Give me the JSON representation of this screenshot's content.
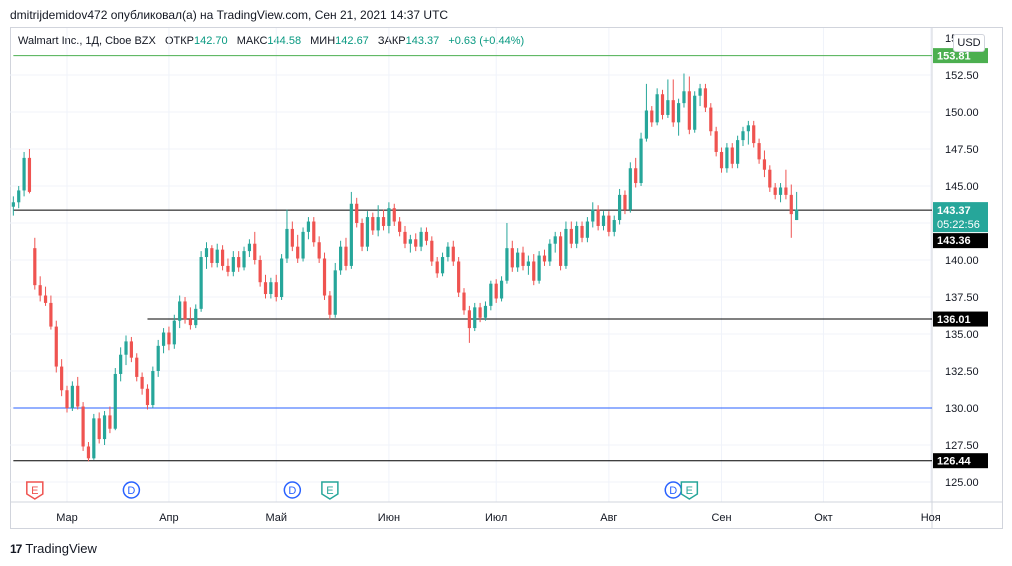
{
  "header": {
    "publisher_line": "dmitrijdemidov472 опубликовал(а) на TradingView.com, Сен 21, 2021 14:37 UTC"
  },
  "legend": {
    "symbol": "Walmart Inc., 1Д, Cboe BZX",
    "open_label": "ОТКР",
    "open": "142.70",
    "high_label": "МАКС",
    "high": "144.58",
    "low_label": "МИН",
    "low": "142.67",
    "close_label": "ЗАКР",
    "close": "143.37",
    "change": "+0.63 (+0.44%)"
  },
  "currency": "USD",
  "footer": {
    "brand": "TradingView"
  },
  "colors": {
    "up": "#26a69a",
    "down": "#ef5350",
    "green_line": "#4caf50",
    "blue_line": "#2962ff",
    "black_line": "#000000"
  },
  "chart_data": {
    "type": "candlestick",
    "y_ticks": [
      "125.00",
      "127.50",
      "130.00",
      "132.50",
      "135.00",
      "137.50",
      "140.00",
      "142.50",
      "145.00",
      "147.50",
      "150.00",
      "152.50"
    ],
    "y_top_partial": "15",
    "ylim": [
      123.3,
      155.3
    ],
    "x_ticks": [
      {
        "label": "Мар",
        "t": 0
      },
      {
        "label": "Апр",
        "t": 19
      },
      {
        "label": "Май",
        "t": 39
      },
      {
        "label": "Июн",
        "t": 60
      },
      {
        "label": "Июл",
        "t": 80
      },
      {
        "label": "Авг",
        "t": 101
      },
      {
        "label": "Сен",
        "t": 122
      },
      {
        "label": "Окт",
        "t": 141
      },
      {
        "label": "Ноя",
        "t": 161
      }
    ],
    "horizontal_lines": [
      {
        "price": 153.81,
        "label": "153.81",
        "color": "green",
        "x_from": -10
      },
      {
        "price": 143.37,
        "label": "143.36",
        "color": "black",
        "x_from": -10
      },
      {
        "price": 136.01,
        "label": "136.01",
        "color": "black",
        "x_from": 15
      },
      {
        "price": 130.0,
        "label": "",
        "color": "blue",
        "x_from": -10
      },
      {
        "price": 126.44,
        "label": "126.44",
        "color": "black",
        "x_from": -10
      }
    ],
    "last_price": {
      "price": 143.37,
      "label": "143.37",
      "countdown": "05:22:56"
    },
    "events": [
      {
        "type": "E",
        "t": -6,
        "color": "down"
      },
      {
        "type": "D",
        "t": 12,
        "color": "blue"
      },
      {
        "type": "D",
        "t": 42,
        "color": "blue"
      },
      {
        "type": "E",
        "t": 49,
        "color": "up"
      },
      {
        "type": "D",
        "t": 113,
        "color": "blue"
      },
      {
        "type": "E",
        "t": 116,
        "color": "up"
      }
    ],
    "candles": [
      {
        "t": -10,
        "o": 143.6,
        "h": 144.3,
        "l": 143.0,
        "c": 143.9
      },
      {
        "t": -9,
        "o": 143.9,
        "h": 145.0,
        "l": 143.5,
        "c": 144.7
      },
      {
        "t": -8,
        "o": 144.7,
        "h": 147.3,
        "l": 144.3,
        "c": 146.9
      },
      {
        "t": -7,
        "o": 146.9,
        "h": 147.5,
        "l": 144.5,
        "c": 144.6
      },
      {
        "t": -6,
        "o": 140.8,
        "h": 141.5,
        "l": 138.0,
        "c": 138.3
      },
      {
        "t": -5,
        "o": 138.3,
        "h": 138.9,
        "l": 137.2,
        "c": 137.6
      },
      {
        "t": -4,
        "o": 137.6,
        "h": 138.2,
        "l": 136.9,
        "c": 137.1
      },
      {
        "t": -3,
        "o": 137.1,
        "h": 137.6,
        "l": 135.3,
        "c": 135.5
      },
      {
        "t": -2,
        "o": 135.5,
        "h": 135.9,
        "l": 132.4,
        "c": 132.8
      },
      {
        "t": -1,
        "o": 132.8,
        "h": 133.3,
        "l": 130.8,
        "c": 131.2
      },
      {
        "t": 0,
        "o": 131.2,
        "h": 131.5,
        "l": 129.7,
        "c": 130.0
      },
      {
        "t": 1,
        "o": 130.0,
        "h": 131.8,
        "l": 129.8,
        "c": 131.5
      },
      {
        "t": 2,
        "o": 131.5,
        "h": 132.1,
        "l": 129.9,
        "c": 130.1
      },
      {
        "t": 3,
        "o": 130.1,
        "h": 130.4,
        "l": 127.1,
        "c": 127.4
      },
      {
        "t": 4,
        "o": 127.4,
        "h": 127.7,
        "l": 126.4,
        "c": 126.6
      },
      {
        "t": 5,
        "o": 126.6,
        "h": 129.6,
        "l": 126.5,
        "c": 129.3
      },
      {
        "t": 6,
        "o": 129.3,
        "h": 129.7,
        "l": 127.6,
        "c": 127.9
      },
      {
        "t": 7,
        "o": 127.9,
        "h": 129.8,
        "l": 127.5,
        "c": 129.5
      },
      {
        "t": 8,
        "o": 129.5,
        "h": 130.1,
        "l": 128.3,
        "c": 128.6
      },
      {
        "t": 9,
        "o": 128.6,
        "h": 132.7,
        "l": 128.5,
        "c": 132.3
      },
      {
        "t": 10,
        "o": 132.3,
        "h": 134.1,
        "l": 131.8,
        "c": 133.6
      },
      {
        "t": 11,
        "o": 133.6,
        "h": 134.9,
        "l": 132.9,
        "c": 134.5
      },
      {
        "t": 12,
        "o": 134.5,
        "h": 134.8,
        "l": 133.1,
        "c": 133.4
      },
      {
        "t": 13,
        "o": 133.4,
        "h": 133.7,
        "l": 131.8,
        "c": 132.1
      },
      {
        "t": 14,
        "o": 132.1,
        "h": 132.4,
        "l": 130.9,
        "c": 131.3
      },
      {
        "t": 15,
        "o": 131.3,
        "h": 131.6,
        "l": 129.9,
        "c": 130.2
      },
      {
        "t": 16,
        "o": 130.2,
        "h": 132.8,
        "l": 130.0,
        "c": 132.5
      },
      {
        "t": 17,
        "o": 132.5,
        "h": 134.6,
        "l": 132.1,
        "c": 134.2
      },
      {
        "t": 18,
        "o": 134.2,
        "h": 135.4,
        "l": 133.7,
        "c": 135.1
      },
      {
        "t": 19,
        "o": 135.1,
        "h": 135.5,
        "l": 133.9,
        "c": 134.3
      },
      {
        "t": 20,
        "o": 134.3,
        "h": 136.3,
        "l": 134.0,
        "c": 135.9
      },
      {
        "t": 21,
        "o": 135.9,
        "h": 137.6,
        "l": 135.4,
        "c": 137.2
      },
      {
        "t": 22,
        "o": 137.2,
        "h": 137.5,
        "l": 135.7,
        "c": 136.0
      },
      {
        "t": 23,
        "o": 136.0,
        "h": 136.8,
        "l": 135.3,
        "c": 135.6
      },
      {
        "t": 24,
        "o": 135.6,
        "h": 137.0,
        "l": 135.4,
        "c": 136.7
      },
      {
        "t": 25,
        "o": 136.7,
        "h": 140.6,
        "l": 136.5,
        "c": 140.2
      },
      {
        "t": 26,
        "o": 140.2,
        "h": 141.2,
        "l": 139.4,
        "c": 140.8
      },
      {
        "t": 27,
        "o": 140.8,
        "h": 141.0,
        "l": 139.5,
        "c": 139.8
      },
      {
        "t": 28,
        "o": 139.8,
        "h": 141.1,
        "l": 139.5,
        "c": 140.7
      },
      {
        "t": 29,
        "o": 140.7,
        "h": 141.0,
        "l": 139.3,
        "c": 139.6
      },
      {
        "t": 30,
        "o": 139.6,
        "h": 140.1,
        "l": 138.9,
        "c": 139.2
      },
      {
        "t": 31,
        "o": 139.2,
        "h": 140.6,
        "l": 138.9,
        "c": 140.2
      },
      {
        "t": 32,
        "o": 140.2,
        "h": 140.6,
        "l": 139.2,
        "c": 139.5
      },
      {
        "t": 33,
        "o": 139.5,
        "h": 140.9,
        "l": 139.3,
        "c": 140.6
      },
      {
        "t": 34,
        "o": 140.6,
        "h": 141.4,
        "l": 140.2,
        "c": 141.1
      },
      {
        "t": 35,
        "o": 141.1,
        "h": 141.9,
        "l": 139.7,
        "c": 140.0
      },
      {
        "t": 36,
        "o": 140.0,
        "h": 140.3,
        "l": 138.2,
        "c": 138.5
      },
      {
        "t": 37,
        "o": 138.5,
        "h": 139.0,
        "l": 137.4,
        "c": 137.7
      },
      {
        "t": 38,
        "o": 137.7,
        "h": 138.8,
        "l": 137.4,
        "c": 138.5
      },
      {
        "t": 39,
        "o": 138.5,
        "h": 139.0,
        "l": 137.2,
        "c": 137.5
      },
      {
        "t": 40,
        "o": 137.5,
        "h": 140.4,
        "l": 137.3,
        "c": 140.1
      },
      {
        "t": 41,
        "o": 140.1,
        "h": 143.4,
        "l": 139.8,
        "c": 142.1
      },
      {
        "t": 42,
        "o": 142.1,
        "h": 142.6,
        "l": 140.6,
        "c": 140.9
      },
      {
        "t": 43,
        "o": 140.9,
        "h": 141.7,
        "l": 139.8,
        "c": 140.1
      },
      {
        "t": 44,
        "o": 140.1,
        "h": 142.2,
        "l": 139.9,
        "c": 141.9
      },
      {
        "t": 45,
        "o": 141.9,
        "h": 142.9,
        "l": 141.4,
        "c": 142.6
      },
      {
        "t": 46,
        "o": 142.6,
        "h": 142.9,
        "l": 140.9,
        "c": 141.2
      },
      {
        "t": 47,
        "o": 141.2,
        "h": 141.6,
        "l": 139.8,
        "c": 140.1
      },
      {
        "t": 48,
        "o": 140.1,
        "h": 140.5,
        "l": 137.3,
        "c": 137.6
      },
      {
        "t": 49,
        "o": 137.6,
        "h": 137.9,
        "l": 136.0,
        "c": 136.3
      },
      {
        "t": 50,
        "o": 136.3,
        "h": 139.8,
        "l": 136.1,
        "c": 139.3
      },
      {
        "t": 51,
        "o": 139.3,
        "h": 141.3,
        "l": 139.0,
        "c": 140.9
      },
      {
        "t": 52,
        "o": 140.9,
        "h": 141.5,
        "l": 139.3,
        "c": 139.6
      },
      {
        "t": 53,
        "o": 139.6,
        "h": 144.6,
        "l": 139.4,
        "c": 143.8
      },
      {
        "t": 54,
        "o": 143.8,
        "h": 144.2,
        "l": 142.2,
        "c": 142.5
      },
      {
        "t": 55,
        "o": 142.5,
        "h": 142.8,
        "l": 140.6,
        "c": 140.9
      },
      {
        "t": 56,
        "o": 140.9,
        "h": 143.3,
        "l": 140.6,
        "c": 142.9
      },
      {
        "t": 57,
        "o": 142.9,
        "h": 143.2,
        "l": 141.7,
        "c": 142.0
      },
      {
        "t": 58,
        "o": 142.0,
        "h": 143.7,
        "l": 141.6,
        "c": 142.9
      },
      {
        "t": 59,
        "o": 142.9,
        "h": 143.4,
        "l": 142.0,
        "c": 142.3
      },
      {
        "t": 60,
        "o": 142.3,
        "h": 143.9,
        "l": 141.8,
        "c": 143.5
      },
      {
        "t": 61,
        "o": 143.5,
        "h": 143.8,
        "l": 142.3,
        "c": 142.6
      },
      {
        "t": 62,
        "o": 142.6,
        "h": 142.9,
        "l": 141.6,
        "c": 141.9
      },
      {
        "t": 63,
        "o": 141.9,
        "h": 142.3,
        "l": 140.8,
        "c": 141.1
      },
      {
        "t": 64,
        "o": 141.1,
        "h": 141.7,
        "l": 140.5,
        "c": 141.4
      },
      {
        "t": 65,
        "o": 141.4,
        "h": 141.8,
        "l": 140.6,
        "c": 140.9
      },
      {
        "t": 66,
        "o": 140.9,
        "h": 142.2,
        "l": 140.6,
        "c": 141.9
      },
      {
        "t": 67,
        "o": 141.9,
        "h": 142.2,
        "l": 141.0,
        "c": 141.3
      },
      {
        "t": 68,
        "o": 141.3,
        "h": 141.6,
        "l": 139.6,
        "c": 139.9
      },
      {
        "t": 69,
        "o": 139.9,
        "h": 140.2,
        "l": 138.8,
        "c": 139.1
      },
      {
        "t": 70,
        "o": 139.1,
        "h": 140.5,
        "l": 138.9,
        "c": 140.2
      },
      {
        "t": 71,
        "o": 140.2,
        "h": 141.2,
        "l": 139.9,
        "c": 140.9
      },
      {
        "t": 72,
        "o": 140.9,
        "h": 141.3,
        "l": 139.6,
        "c": 139.9
      },
      {
        "t": 73,
        "o": 139.9,
        "h": 140.2,
        "l": 137.5,
        "c": 137.8
      },
      {
        "t": 74,
        "o": 137.8,
        "h": 138.1,
        "l": 136.3,
        "c": 136.6
      },
      {
        "t": 75,
        "o": 136.6,
        "h": 136.9,
        "l": 134.4,
        "c": 135.4
      },
      {
        "t": 76,
        "o": 135.4,
        "h": 137.1,
        "l": 135.2,
        "c": 136.8
      },
      {
        "t": 77,
        "o": 136.8,
        "h": 137.1,
        "l": 135.8,
        "c": 136.1
      },
      {
        "t": 78,
        "o": 136.1,
        "h": 137.2,
        "l": 135.9,
        "c": 136.9
      },
      {
        "t": 79,
        "o": 136.9,
        "h": 138.6,
        "l": 136.6,
        "c": 138.4
      },
      {
        "t": 80,
        "o": 138.4,
        "h": 138.7,
        "l": 137.1,
        "c": 137.4
      },
      {
        "t": 81,
        "o": 137.4,
        "h": 138.9,
        "l": 137.2,
        "c": 138.6
      },
      {
        "t": 82,
        "o": 138.6,
        "h": 142.5,
        "l": 138.4,
        "c": 140.8
      },
      {
        "t": 83,
        "o": 140.8,
        "h": 141.3,
        "l": 139.2,
        "c": 139.5
      },
      {
        "t": 84,
        "o": 139.5,
        "h": 140.8,
        "l": 139.2,
        "c": 140.5
      },
      {
        "t": 85,
        "o": 140.5,
        "h": 140.9,
        "l": 139.3,
        "c": 139.6
      },
      {
        "t": 86,
        "o": 139.6,
        "h": 140.3,
        "l": 139.0,
        "c": 139.9
      },
      {
        "t": 87,
        "o": 139.9,
        "h": 140.4,
        "l": 138.3,
        "c": 138.6
      },
      {
        "t": 88,
        "o": 138.6,
        "h": 140.6,
        "l": 138.4,
        "c": 140.3
      },
      {
        "t": 89,
        "o": 140.3,
        "h": 140.7,
        "l": 139.6,
        "c": 139.9
      },
      {
        "t": 90,
        "o": 139.9,
        "h": 141.4,
        "l": 139.6,
        "c": 141.1
      },
      {
        "t": 91,
        "o": 141.1,
        "h": 141.9,
        "l": 140.5,
        "c": 141.6
      },
      {
        "t": 92,
        "o": 141.6,
        "h": 141.9,
        "l": 139.3,
        "c": 139.6
      },
      {
        "t": 93,
        "o": 139.6,
        "h": 142.6,
        "l": 139.4,
        "c": 142.1
      },
      {
        "t": 94,
        "o": 142.1,
        "h": 142.6,
        "l": 140.8,
        "c": 141.1
      },
      {
        "t": 95,
        "o": 141.1,
        "h": 142.6,
        "l": 140.8,
        "c": 142.3
      },
      {
        "t": 96,
        "o": 142.3,
        "h": 142.6,
        "l": 141.2,
        "c": 141.5
      },
      {
        "t": 97,
        "o": 141.5,
        "h": 142.9,
        "l": 141.2,
        "c": 142.6
      },
      {
        "t": 98,
        "o": 142.6,
        "h": 143.9,
        "l": 142.2,
        "c": 143.4
      },
      {
        "t": 99,
        "o": 143.4,
        "h": 143.7,
        "l": 142.0,
        "c": 142.3
      },
      {
        "t": 100,
        "o": 142.3,
        "h": 143.3,
        "l": 142.0,
        "c": 143.0
      },
      {
        "t": 101,
        "o": 143.0,
        "h": 143.3,
        "l": 141.6,
        "c": 141.9
      },
      {
        "t": 102,
        "o": 141.9,
        "h": 143.0,
        "l": 141.6,
        "c": 142.7
      },
      {
        "t": 103,
        "o": 142.7,
        "h": 144.8,
        "l": 142.4,
        "c": 144.4
      },
      {
        "t": 104,
        "o": 144.4,
        "h": 144.7,
        "l": 143.1,
        "c": 143.4
      },
      {
        "t": 105,
        "o": 143.4,
        "h": 146.6,
        "l": 143.2,
        "c": 146.2
      },
      {
        "t": 106,
        "o": 146.2,
        "h": 146.9,
        "l": 144.9,
        "c": 145.2
      },
      {
        "t": 107,
        "o": 145.2,
        "h": 148.6,
        "l": 145.0,
        "c": 148.2
      },
      {
        "t": 108,
        "o": 148.2,
        "h": 151.9,
        "l": 148.0,
        "c": 150.1
      },
      {
        "t": 109,
        "o": 150.1,
        "h": 150.4,
        "l": 149.0,
        "c": 149.3
      },
      {
        "t": 110,
        "o": 149.3,
        "h": 151.6,
        "l": 149.1,
        "c": 151.2
      },
      {
        "t": 111,
        "o": 151.2,
        "h": 151.5,
        "l": 149.5,
        "c": 149.8
      },
      {
        "t": 112,
        "o": 149.8,
        "h": 152.2,
        "l": 149.6,
        "c": 150.8
      },
      {
        "t": 113,
        "o": 150.8,
        "h": 152.2,
        "l": 149.0,
        "c": 149.3
      },
      {
        "t": 114,
        "o": 149.3,
        "h": 150.9,
        "l": 148.4,
        "c": 150.6
      },
      {
        "t": 115,
        "o": 150.6,
        "h": 152.6,
        "l": 150.3,
        "c": 151.4
      },
      {
        "t": 116,
        "o": 151.4,
        "h": 152.4,
        "l": 148.5,
        "c": 148.8
      },
      {
        "t": 117,
        "o": 148.8,
        "h": 151.4,
        "l": 148.6,
        "c": 151.1
      },
      {
        "t": 118,
        "o": 151.1,
        "h": 151.9,
        "l": 150.4,
        "c": 151.6
      },
      {
        "t": 119,
        "o": 151.6,
        "h": 151.9,
        "l": 150.0,
        "c": 150.3
      },
      {
        "t": 120,
        "o": 150.3,
        "h": 150.6,
        "l": 148.4,
        "c": 148.7
      },
      {
        "t": 121,
        "o": 148.7,
        "h": 149.0,
        "l": 147.0,
        "c": 147.3
      },
      {
        "t": 122,
        "o": 147.3,
        "h": 147.6,
        "l": 145.9,
        "c": 146.2
      },
      {
        "t": 123,
        "o": 146.2,
        "h": 147.9,
        "l": 145.9,
        "c": 147.6
      },
      {
        "t": 124,
        "o": 147.6,
        "h": 147.9,
        "l": 146.2,
        "c": 146.5
      },
      {
        "t": 125,
        "o": 146.5,
        "h": 148.4,
        "l": 146.2,
        "c": 148.1
      },
      {
        "t": 126,
        "o": 148.1,
        "h": 149.0,
        "l": 147.7,
        "c": 148.7
      },
      {
        "t": 127,
        "o": 148.7,
        "h": 149.4,
        "l": 147.8,
        "c": 149.1
      },
      {
        "t": 128,
        "o": 149.1,
        "h": 149.4,
        "l": 147.6,
        "c": 147.9
      },
      {
        "t": 129,
        "o": 147.9,
        "h": 148.2,
        "l": 146.5,
        "c": 146.8
      },
      {
        "t": 130,
        "o": 146.8,
        "h": 147.4,
        "l": 145.6,
        "c": 146.1
      },
      {
        "t": 131,
        "o": 146.1,
        "h": 146.4,
        "l": 144.6,
        "c": 144.9
      },
      {
        "t": 132,
        "o": 144.9,
        "h": 145.2,
        "l": 144.1,
        "c": 144.4
      },
      {
        "t": 133,
        "o": 144.4,
        "h": 145.2,
        "l": 143.9,
        "c": 144.9
      },
      {
        "t": 134,
        "o": 144.9,
        "h": 146.1,
        "l": 144.1,
        "c": 144.4
      },
      {
        "t": 135,
        "o": 144.4,
        "h": 145.1,
        "l": 141.5,
        "c": 143.1
      },
      {
        "t": 136,
        "o": 142.7,
        "h": 144.6,
        "l": 142.7,
        "c": 143.4
      }
    ]
  }
}
